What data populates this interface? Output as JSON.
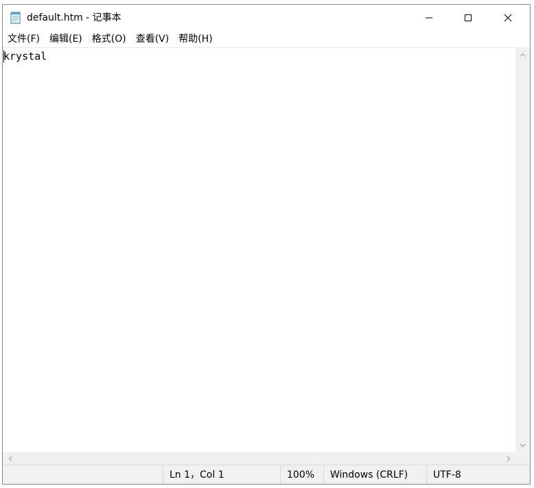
{
  "window": {
    "title": "default.htm - 记事本"
  },
  "menu": {
    "items": [
      {
        "label": "文件(F)"
      },
      {
        "label": "编辑(E)"
      },
      {
        "label": "格式(O)"
      },
      {
        "label": "查看(V)"
      },
      {
        "label": "帮助(H)"
      }
    ]
  },
  "editor": {
    "content": "krystal"
  },
  "status": {
    "position": "Ln 1，Col 1",
    "zoom": "100%",
    "line_ending": "Windows (CRLF)",
    "encoding": "UTF-8"
  },
  "icons": {
    "app": "notepad-icon",
    "minimize": "minimize-icon",
    "maximize": "maximize-icon",
    "close": "close-icon"
  },
  "colors": {
    "background": "#ffffff",
    "chrome": "#f0f0f0",
    "text": "#000000"
  }
}
